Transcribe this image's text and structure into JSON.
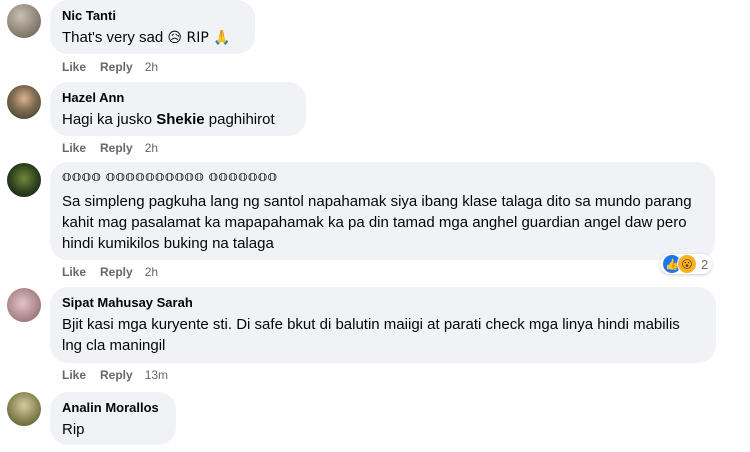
{
  "actions": {
    "like": "Like",
    "reply": "Reply"
  },
  "comments": [
    {
      "author": "Nic Tanti",
      "text": "That's very sad",
      "emojis": "😥 RIP 🙏",
      "time": "2h"
    },
    {
      "author": "Hazel Ann",
      "text_before": "Hagi ka jusko ",
      "mention": "Shekie",
      "text_after": " paghihirot",
      "time": "2h"
    },
    {
      "author": "𝕆𝕆𝕆𝕆 𝕆𝕆𝕆𝕆𝕆𝕆𝕆𝕆𝕆𝕆 𝕆𝕆𝕆𝕆𝕆𝕆𝕆",
      "text": "Sa simpleng pagkuha lang ng santol napahamak siya ibang klase talaga dito sa mundo parang kahit mag pasalamat ka mapapahamak ka pa din tamad mga anghel guardian angel daw pero hindi kumikilos buking na talaga",
      "time": "2h",
      "reaction_count": "2"
    },
    {
      "author": "Sipat Mahusay Sarah",
      "text": "Bjit kasi mga kuryente sti. Di safe bkut di balutin maiigi at parati check mga linya hindi mabilis lng cla maningil",
      "time": "13m"
    },
    {
      "author": "Analin Morallos",
      "text": "Rip",
      "time": ""
    }
  ],
  "colors": {
    "bubble": "#f0f2f5",
    "meta": "#65676b",
    "like_reaction": "#1877f2",
    "wow_reaction": "#f7b125"
  }
}
